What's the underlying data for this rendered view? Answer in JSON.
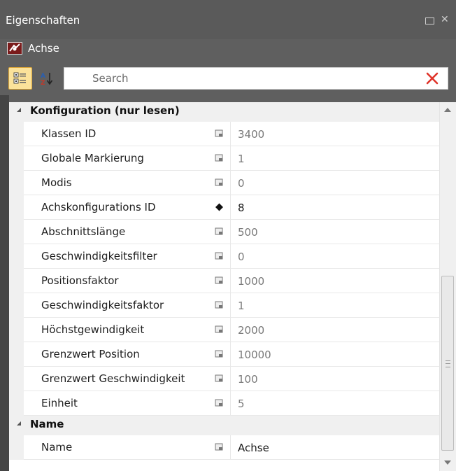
{
  "window": {
    "title": "Eigenschaften",
    "maximize_icon": "maximize-icon",
    "close_icon": "close-icon"
  },
  "object": {
    "name": "Achse",
    "icon": "axis-object-icon"
  },
  "toolbar": {
    "categorized_icon": "categorized-view-icon",
    "alphabetical_icon": "alphabetical-sort-icon",
    "categorized_active": true,
    "search_placeholder": "Search",
    "clear_icon": "clear-search-icon",
    "clear_color": "#e0342a"
  },
  "categories": [
    {
      "label": "Konfiguration (nur lesen)",
      "properties": [
        {
          "name": "Klassen ID",
          "value": "3400",
          "marker": "readonly"
        },
        {
          "name": "Globale Markierung",
          "value": "1",
          "marker": "readonly"
        },
        {
          "name": "Modis",
          "value": "0",
          "marker": "readonly"
        },
        {
          "name": "Achskonfigurations ID",
          "value": "8",
          "marker": "editable"
        },
        {
          "name": "Abschnittslänge",
          "value": "500",
          "marker": "readonly"
        },
        {
          "name": "Geschwindigkeitsfilter",
          "value": "0",
          "marker": "readonly"
        },
        {
          "name": "Positionsfaktor",
          "value": "1000",
          "marker": "readonly"
        },
        {
          "name": "Geschwindigkeitsfaktor",
          "value": "1",
          "marker": "readonly"
        },
        {
          "name": "Höchstgewindigkeit",
          "value": "2000",
          "marker": "readonly"
        },
        {
          "name": "Grenzwert Position",
          "value": "10000",
          "marker": "readonly"
        },
        {
          "name": "Grenzwert Geschwindigkeit",
          "value": "100",
          "marker": "readonly"
        },
        {
          "name": "Einheit",
          "value": "5",
          "marker": "readonly"
        }
      ]
    },
    {
      "label": "Name",
      "properties": [
        {
          "name": "Name",
          "value": "Achse",
          "marker": "readonly-editable"
        }
      ]
    }
  ],
  "colors": {
    "panel_dark": "#454545",
    "header": "#5a5a5a",
    "category_bg": "#f0f0f0",
    "toggle_active": "#fbe29a"
  }
}
